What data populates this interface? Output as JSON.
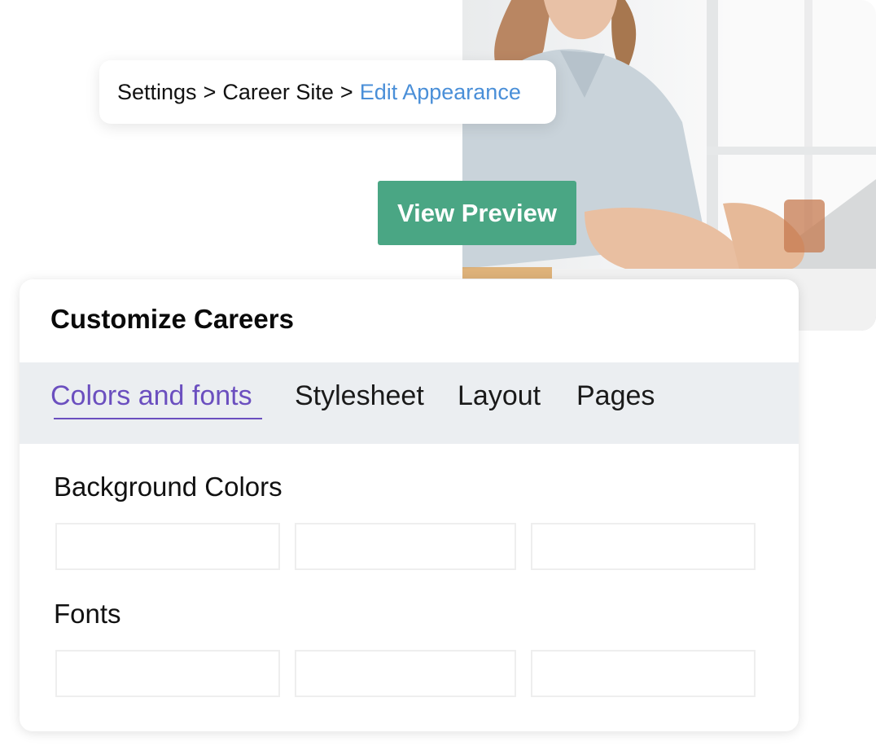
{
  "breadcrumb": {
    "items": [
      "Settings",
      "Career Site"
    ],
    "separator": ">",
    "current": "Edit Appearance"
  },
  "actions": {
    "view_preview": "View Preview"
  },
  "panel": {
    "title": "Customize Careers",
    "tabs": [
      {
        "label": "Colors and fonts",
        "active": true
      },
      {
        "label": "Stylesheet",
        "active": false
      },
      {
        "label": "Layout",
        "active": false
      },
      {
        "label": "Pages",
        "active": false
      }
    ],
    "sections": {
      "background_colors": "Background Colors",
      "fonts": "Fonts"
    }
  },
  "colors": {
    "accent_tab": "#6b4fbf",
    "button": "#4aa684",
    "breadcrumb_active": "#4a8fd8",
    "tabs_bar": "#ebeef1"
  }
}
